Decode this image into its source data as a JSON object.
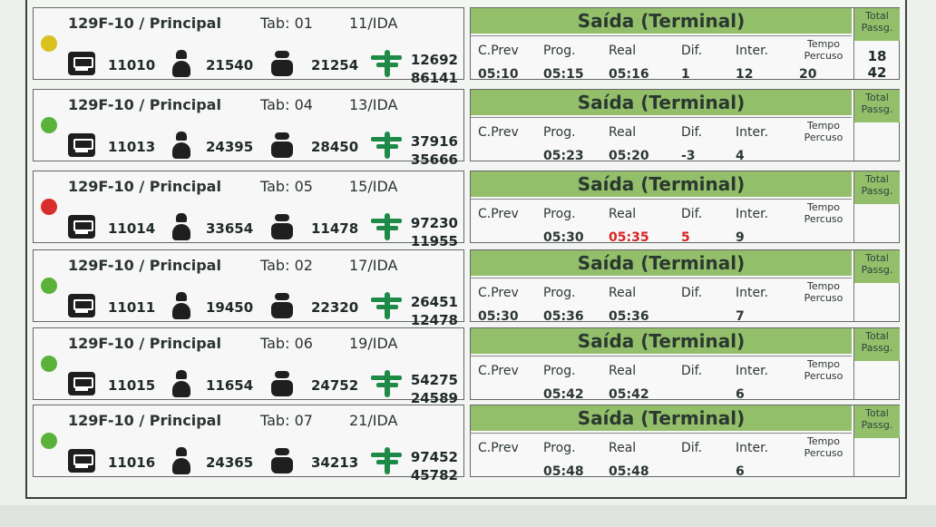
{
  "rows": [
    {
      "status_color": "#d9c21f",
      "route": "129F-10 / Principal",
      "tab": "Tab: 01",
      "trip": "11/IDA",
      "bus": "11010",
      "driver": "21540",
      "collector": "21254",
      "turnstile_top": "12692",
      "turnstile_bottom": "86141",
      "header": "Saída (Terminal)",
      "total_label": "Total Passg.",
      "labels": [
        "C.Prev",
        "Prog.",
        "Real",
        "Dif.",
        "Inter.",
        "Tempo Percuso"
      ],
      "values": [
        "05:10",
        "05:15",
        "05:16",
        "1",
        "12",
        "20"
      ],
      "total_top": "18",
      "total_bottom": "42"
    },
    {
      "status_color": "#5ab23b",
      "route": "129F-10 / Principal",
      "tab": "Tab: 04",
      "trip": "13/IDA",
      "bus": "11013",
      "driver": "24395",
      "collector": "28450",
      "turnstile_top": "37916",
      "turnstile_bottom": "35666",
      "header": "Saída (Terminal)",
      "total_label": "Total Passg.",
      "labels": [
        "C.Prev",
        "Prog.",
        "Real",
        "Dif.",
        "Inter.",
        "Tempo Percuso"
      ],
      "values": [
        "",
        "05:23",
        "05:20",
        "-3",
        "4",
        ""
      ],
      "total_top": "",
      "total_bottom": ""
    },
    {
      "status_color": "#d92e2e",
      "route": "129F-10 / Principal",
      "tab": "Tab: 05",
      "trip": "15/IDA",
      "bus": "11014",
      "driver": "33654",
      "collector": "11478",
      "turnstile_top": "97230",
      "turnstile_bottom": "11955",
      "header": "Saída (Terminal)",
      "total_label": "Total Passg.",
      "labels": [
        "C.Prev",
        "Prog.",
        "Real",
        "Dif.",
        "Inter.",
        "Tempo Percuso"
      ],
      "values": [
        "",
        "05:30",
        "05:35",
        "5",
        "9",
        ""
      ],
      "total_top": "",
      "total_bottom": ""
    },
    {
      "status_color": "#5ab23b",
      "route": "129F-10 / Principal",
      "tab": "Tab: 02",
      "trip": "17/IDA",
      "bus": "11011",
      "driver": "19450",
      "collector": "22320",
      "turnstile_top": "26451",
      "turnstile_bottom": "12478",
      "header": "Saída (Terminal)",
      "total_label": "Total Passg.",
      "labels": [
        "C.Prev",
        "Prog.",
        "Real",
        "Dif.",
        "Inter.",
        "Tempo Percuso"
      ],
      "values": [
        "05:30",
        "05:36",
        "05:36",
        "",
        "7",
        ""
      ],
      "total_top": "",
      "total_bottom": ""
    },
    {
      "status_color": "#5ab23b",
      "route": "129F-10 / Principal",
      "tab": "Tab: 06",
      "trip": "19/IDA",
      "bus": "11015",
      "driver": "11654",
      "collector": "24752",
      "turnstile_top": "54275",
      "turnstile_bottom": "24589",
      "header": "Saída (Terminal)",
      "total_label": "Total Passg.",
      "labels": [
        "C.Prev",
        "Prog.",
        "Real",
        "Dif.",
        "Inter.",
        "Tempo Percuso"
      ],
      "values": [
        "",
        "05:42",
        "05:42",
        "",
        "6",
        ""
      ],
      "total_top": "",
      "total_bottom": ""
    },
    {
      "status_color": "#5ab23b",
      "route": "129F-10 / Principal",
      "tab": "Tab: 07",
      "trip": "21/IDA",
      "bus": "11016",
      "driver": "24365",
      "collector": "34213",
      "turnstile_top": "97452",
      "turnstile_bottom": "45782",
      "header": "Saída (Terminal)",
      "total_label": "Total Passg.",
      "labels": [
        "C.Prev",
        "Prog.",
        "Real",
        "Dif.",
        "Inter.",
        "Tempo Percuso"
      ],
      "values": [
        "",
        "05:48",
        "05:48",
        "",
        "6",
        ""
      ],
      "total_top": "",
      "total_bottom": ""
    }
  ]
}
